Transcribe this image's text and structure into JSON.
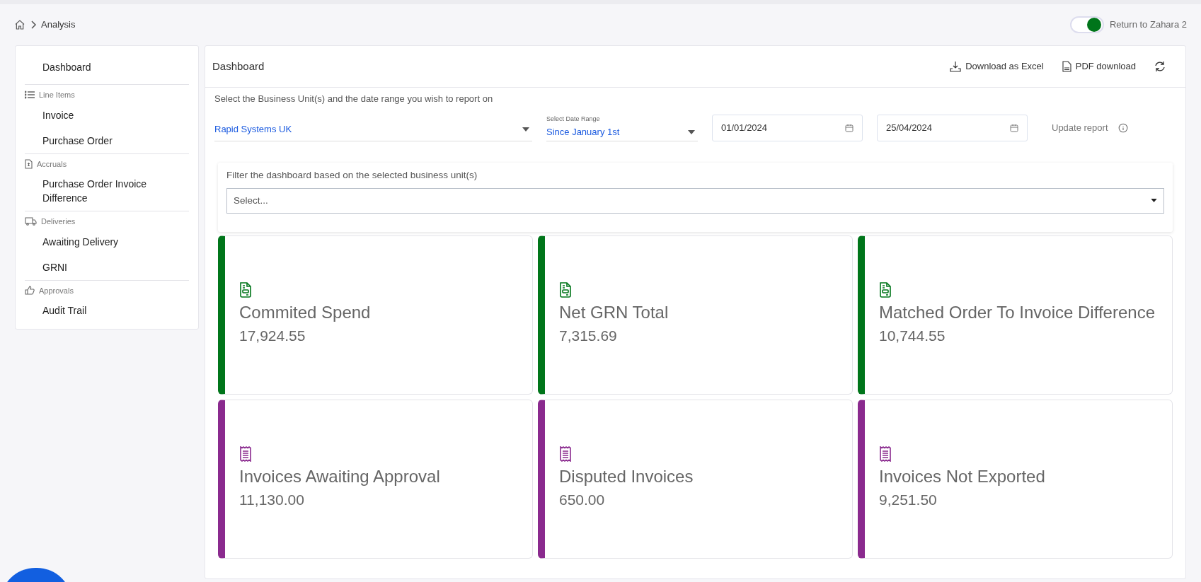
{
  "breadcrumb": {
    "current": "Analysis"
  },
  "toggle": {
    "label": "Return to Zahara 2",
    "on": true
  },
  "sidebar": {
    "sections": [
      {
        "items": [
          "Dashboard"
        ]
      },
      {
        "heading": "Line Items",
        "kind": "list",
        "items": [
          "Invoice",
          "Purchase Order"
        ]
      },
      {
        "heading": "Accruals",
        "kind": "file",
        "items": [
          "Purchase Order Invoice Difference"
        ]
      },
      {
        "heading": "Deliveries",
        "kind": "truck",
        "items": [
          "Awaiting Delivery",
          "GRNI"
        ]
      },
      {
        "heading": "Approvals",
        "kind": "thumb",
        "items": [
          "Audit Trail"
        ]
      }
    ]
  },
  "main": {
    "title": "Dashboard",
    "actions": [
      {
        "kind": "excel",
        "label": "Download as Excel"
      },
      {
        "kind": "pdf",
        "label": "PDF download"
      },
      {
        "kind": "refresh"
      }
    ],
    "instruction": "Select the Business Unit(s) and the date range you wish to report on",
    "business_unit": {
      "value": "Rapid Systems UK"
    },
    "date_range": {
      "label": "Select Date Range",
      "value": "Since January 1st"
    },
    "start_date": "01/01/2024",
    "end_date": "25/04/2024",
    "update_report": "Update report",
    "filter": {
      "label": "Filter the dashboard based on the selected business unit(s)",
      "placeholder": "Select..."
    },
    "cards": [
      {
        "kind": "document",
        "color": "#00751a",
        "title": "Commited Spend",
        "value": "17,924.55"
      },
      {
        "kind": "document",
        "color": "#00751a",
        "title": "Net GRN Total",
        "value": "7,315.69"
      },
      {
        "kind": "document",
        "color": "#00751a",
        "title": "Matched Order To Invoice Difference",
        "value": "10,744.55"
      },
      {
        "kind": "receipt",
        "color": "#8a2a8e",
        "title": "Invoices Awaiting Approval",
        "value": "11,130.00"
      },
      {
        "kind": "receipt",
        "color": "#8a2a8e",
        "title": "Disputed Invoices",
        "value": "650.00"
      },
      {
        "kind": "receipt",
        "color": "#8a2a8e",
        "title": "Invoices Not Exported",
        "value": "9,251.50"
      }
    ]
  }
}
